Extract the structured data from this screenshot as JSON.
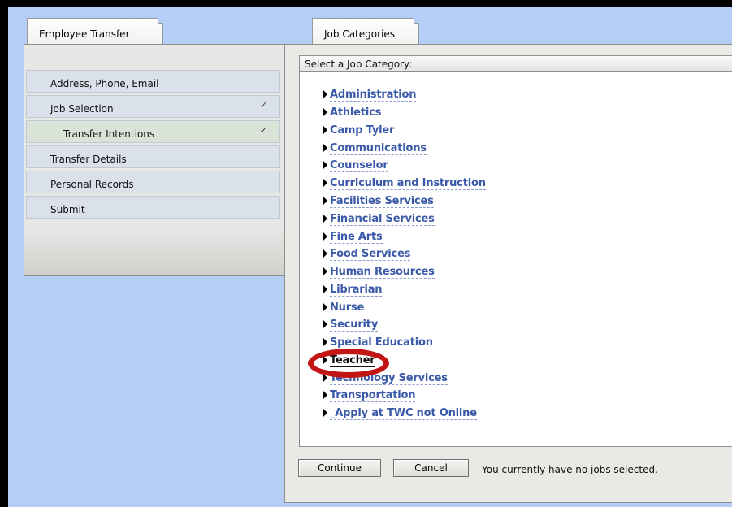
{
  "left_tab": {
    "label": "Employee Transfer"
  },
  "left_menu": [
    {
      "label": "Address, Phone, Email",
      "checked": ""
    },
    {
      "label": "Job Selection",
      "checked": "✓"
    },
    {
      "label": "Transfer Intentions",
      "checked": "✓"
    },
    {
      "label": "Transfer Details",
      "checked": ""
    },
    {
      "label": "Personal Records",
      "checked": ""
    },
    {
      "label": "Submit",
      "checked": ""
    }
  ],
  "right_tab": {
    "label": "Job Categories"
  },
  "category_header": "Select a Job Category:",
  "categories": [
    "Administration",
    "Athletics",
    "Camp Tyler",
    "Communications",
    "Counselor",
    "Curriculum and Instruction",
    "Facilities Services",
    "Financial Services",
    "Fine Arts",
    "Food Services",
    "Human Resources",
    "Librarian",
    "Nurse",
    "Security",
    "Special Education",
    "Teacher",
    "Technology Services",
    "Transportation",
    "_Apply at TWC not Online"
  ],
  "selected_category": "Teacher",
  "buttons": {
    "continue": "Continue",
    "cancel": "Cancel"
  },
  "status": "You currently have no jobs selected.",
  "colors": {
    "background": "#b4cef6",
    "link": "#3a59a8",
    "highlight_circle": "#c41515"
  }
}
